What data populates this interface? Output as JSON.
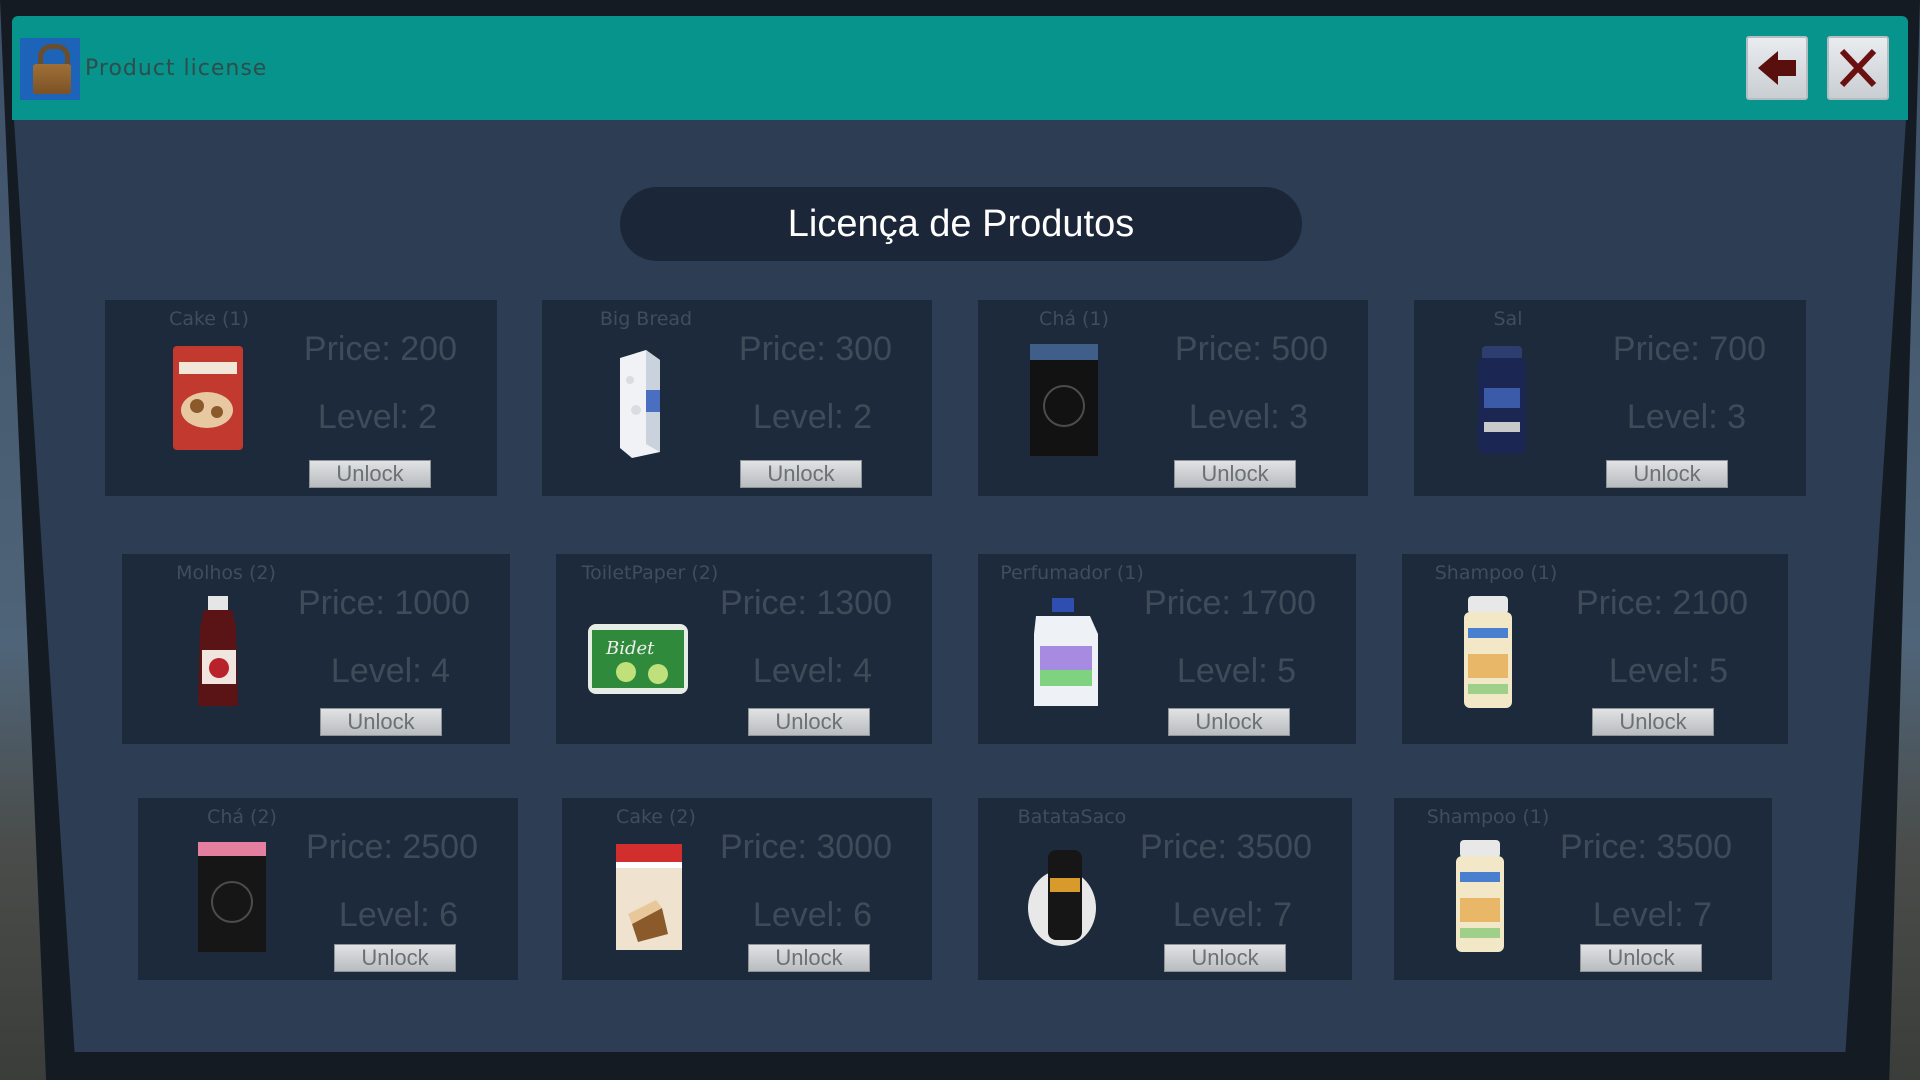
{
  "window": {
    "title": "Product license",
    "icon": "lock-icon",
    "back_icon": "arrow-left-icon",
    "close_icon": "close-icon"
  },
  "panel": {
    "heading": "Licença de Produtos"
  },
  "colors": {
    "titlebar": "#07948c",
    "panel": "#2c3d54",
    "card": "#1d2a3b",
    "heading_pill": "#1b2638"
  },
  "products": [
    {
      "name": "Cake (1)",
      "price": "Price: 200",
      "level": "Level: 2",
      "button": "Unlock",
      "icon": "cake-bag-icon"
    },
    {
      "name": "Big Bread",
      "price": "Price: 300",
      "level": "Level: 2",
      "button": "Unlock",
      "icon": "bread-loaf-icon"
    },
    {
      "name": "Chá (1)",
      "price": "Price: 500",
      "level": "Level: 3",
      "button": "Unlock",
      "icon": "tea-box-icon"
    },
    {
      "name": "Sal",
      "price": "Price: 700",
      "level": "Level: 3",
      "button": "Unlock",
      "icon": "salt-shaker-icon"
    },
    {
      "name": "Molhos (2)",
      "price": "Price: 1000",
      "level": "Level: 4",
      "button": "Unlock",
      "icon": "sauce-bottle-icon"
    },
    {
      "name": "ToiletPaper (2)",
      "price": "Price: 1300",
      "level": "Level: 4",
      "button": "Unlock",
      "icon": "toilet-paper-icon"
    },
    {
      "name": "Perfumador (1)",
      "price": "Price: 1700",
      "level": "Level: 5",
      "button": "Unlock",
      "icon": "detergent-jug-icon"
    },
    {
      "name": "Shampoo (1)",
      "price": "Price: 2100",
      "level": "Level: 5",
      "button": "Unlock",
      "icon": "shampoo-bottle-icon"
    },
    {
      "name": "Chá (2)",
      "price": "Price: 2500",
      "level": "Level: 6",
      "button": "Unlock",
      "icon": "tea-box-pink-icon"
    },
    {
      "name": "Cake (2)",
      "price": "Price: 3000",
      "level": "Level: 6",
      "button": "Unlock",
      "icon": "cake-box-icon"
    },
    {
      "name": "BatataSaco",
      "price": "Price: 3500",
      "level": "Level: 7",
      "button": "Unlock",
      "icon": "chips-bag-icon"
    },
    {
      "name": "Shampoo (1)",
      "price": "Price: 3500",
      "level": "Level: 7",
      "button": "Unlock",
      "icon": "shampoo-bottle-icon"
    }
  ]
}
